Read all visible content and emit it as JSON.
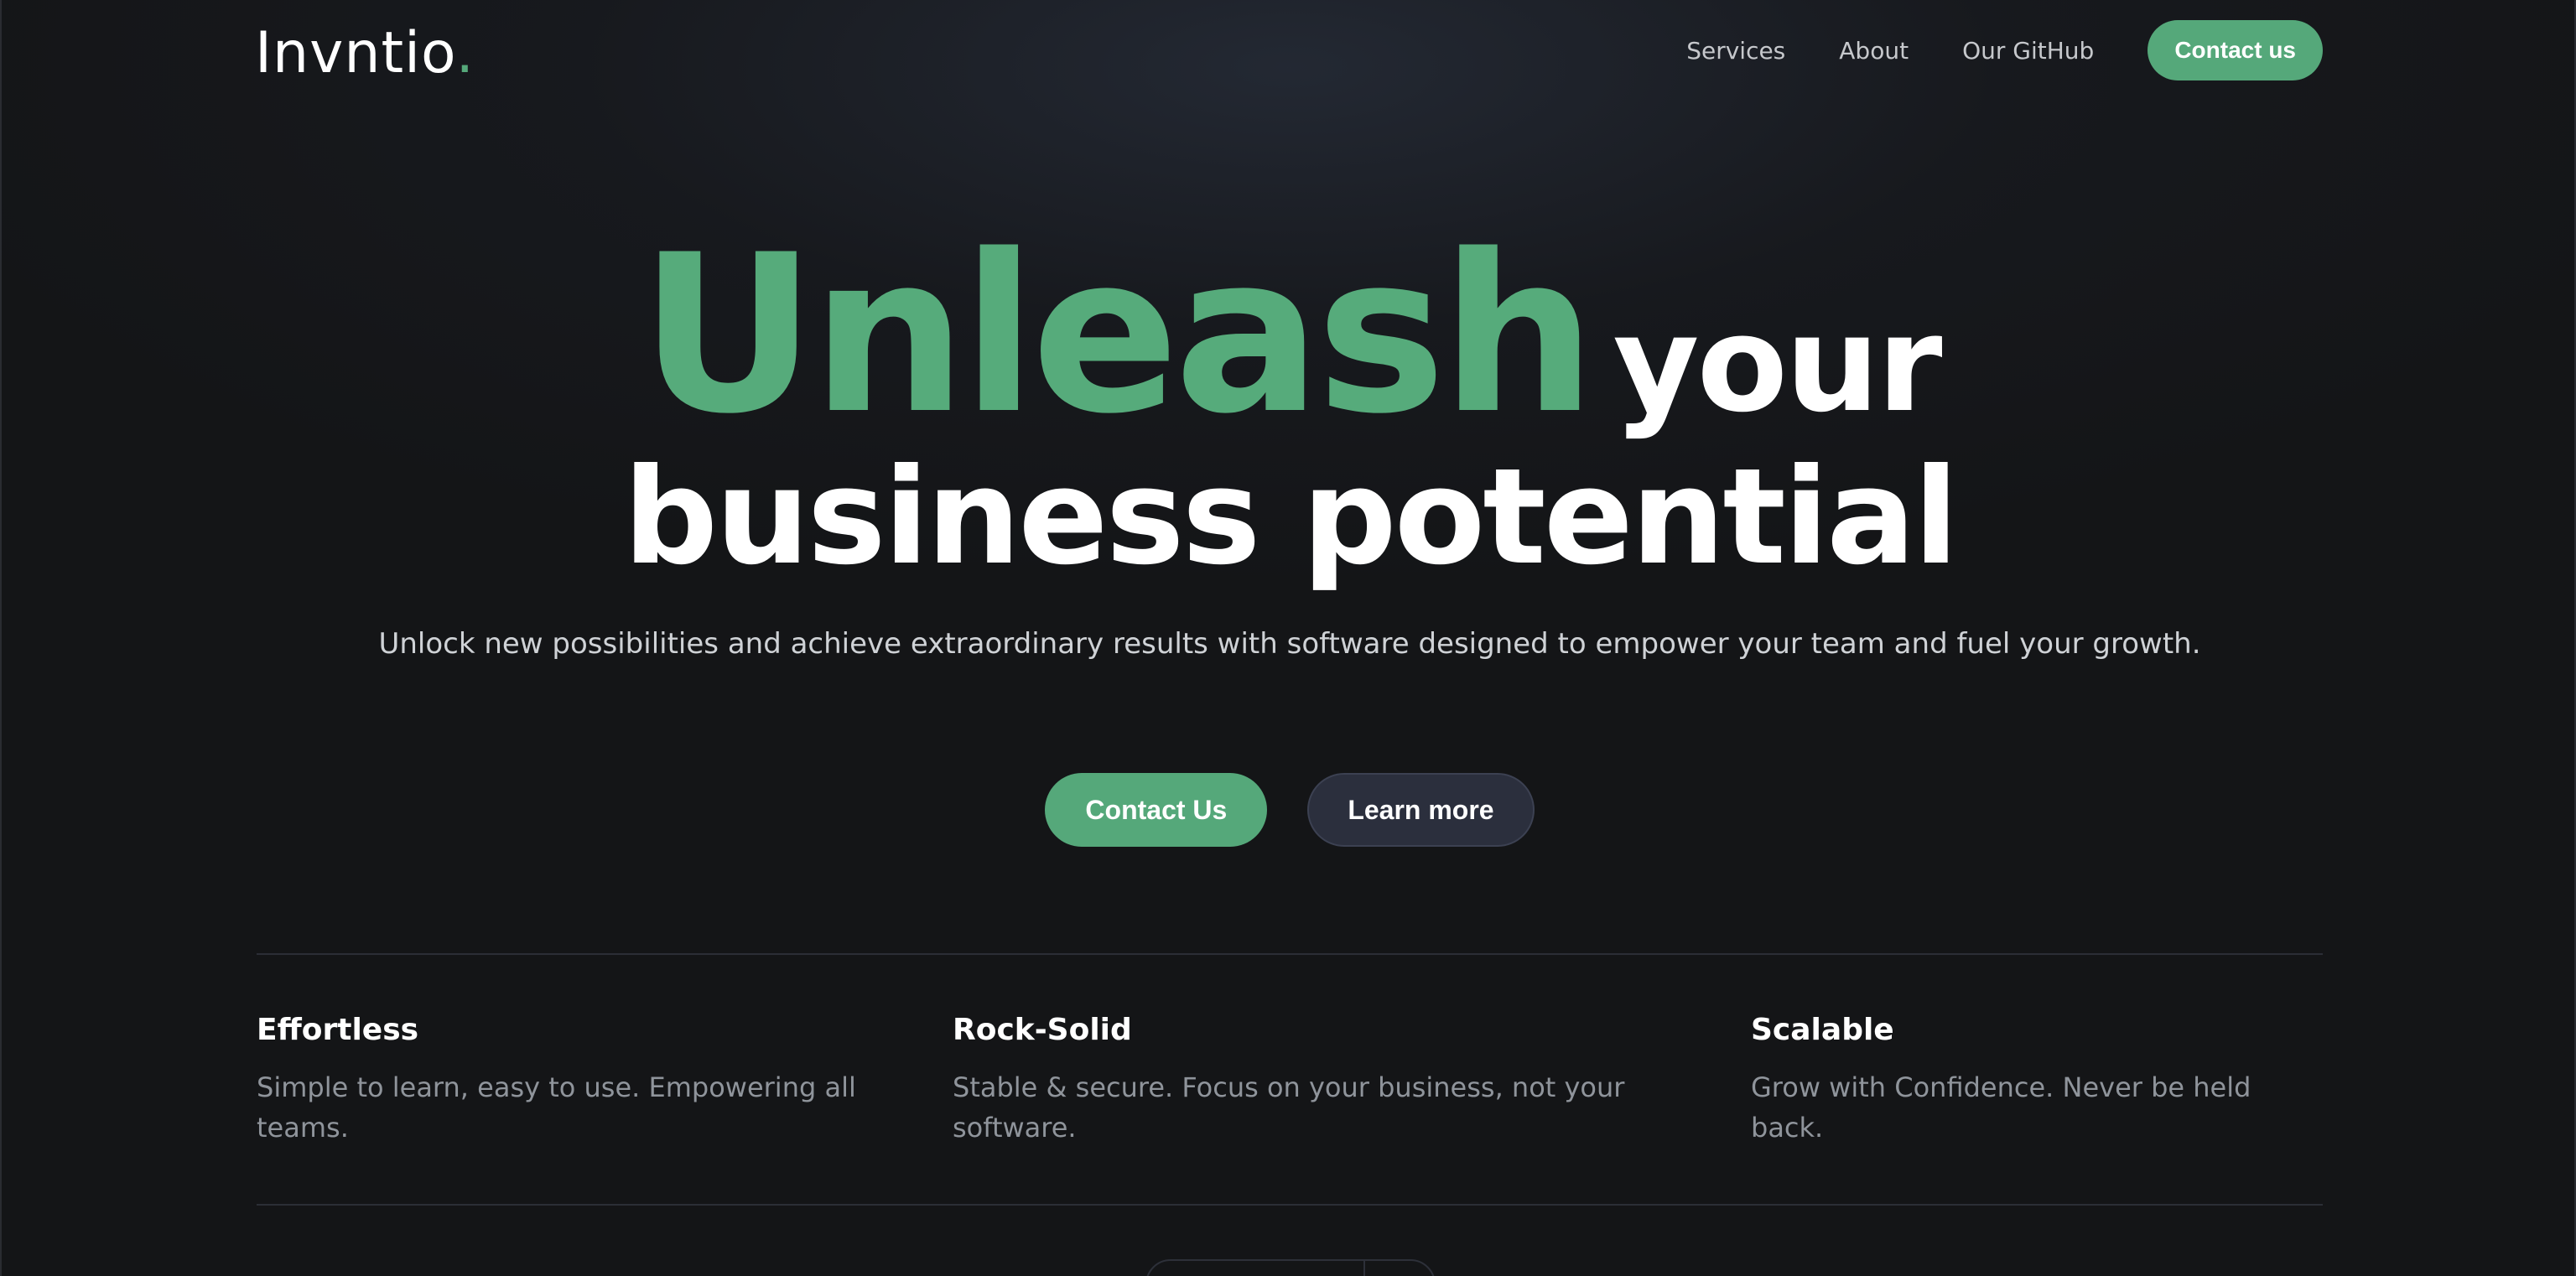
{
  "nav": {
    "logo_text": "Invntio",
    "logo_dot": ".",
    "links": [
      "Services",
      "About",
      "Our GitHub"
    ],
    "cta_label": "Contact us"
  },
  "hero": {
    "title_highlight": "Unleash",
    "title_rest_line1": "your",
    "title_line2": "business potential",
    "subtitle": "Unlock new possibilities and achieve extraordinary results with software designed to empower your team and fuel your growth.",
    "primary_button": "Contact Us",
    "secondary_button": "Learn more"
  },
  "features": [
    {
      "title": "Effortless",
      "description": "Simple to learn, easy to use. Empowering all teams."
    },
    {
      "title": "Rock-Solid",
      "description": "Stable & secure. Focus on your business, not your software."
    },
    {
      "title": "Scalable",
      "description": "Grow with Confidence. Never be held back."
    }
  ],
  "colors": {
    "accent": "#55a87a",
    "background": "#141517",
    "secondary_button": "#2b2f3d"
  }
}
